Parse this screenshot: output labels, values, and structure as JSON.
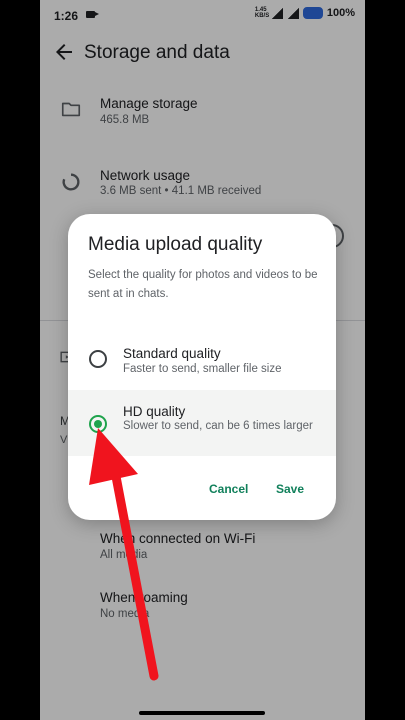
{
  "status_bar": {
    "time": "1:26",
    "battery": "100%",
    "speed": "1.45 KB/S"
  },
  "app_bar": {
    "title": "Storage and data"
  },
  "settings": [
    {
      "title": "Manage storage",
      "subtitle": "465.8 MB"
    },
    {
      "title": "Network usage",
      "subtitle": "3.6 MB sent • 41.1 MB received"
    }
  ],
  "partial_labels": {
    "left_letter_1": "M",
    "left_letter_2": "V"
  },
  "download_rows": [
    {
      "title": "When connected on Wi-Fi",
      "subtitle": "All media"
    },
    {
      "title": "When roaming",
      "subtitle": "No media"
    }
  ],
  "dialog": {
    "title": "Media upload quality",
    "description": "Select the quality for photos and videos to be sent at in chats.",
    "options": [
      {
        "title": "Standard quality",
        "subtitle": "Faster to send, smaller file size",
        "selected": false
      },
      {
        "title": "HD quality",
        "subtitle": "Slower to send, can be 6 times larger",
        "selected": true
      }
    ],
    "cancel_label": "Cancel",
    "save_label": "Save"
  },
  "colors": {
    "accent": "#11805b",
    "radio_selected": "#1ea34c",
    "annotation_arrow": "#f0141e"
  },
  "icons": {
    "back": "arrow-left-icon",
    "storage": "folder-icon",
    "network": "data-usage-icon",
    "video": "video-icon"
  }
}
